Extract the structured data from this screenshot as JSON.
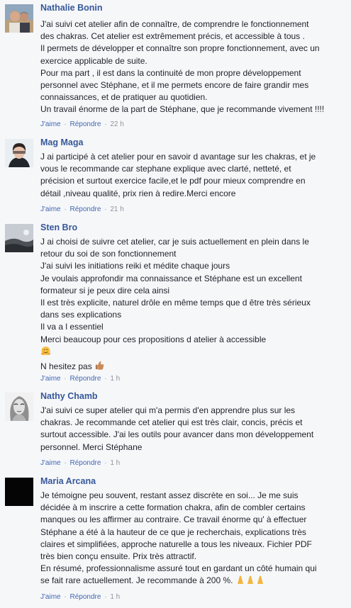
{
  "actions": {
    "like": "J'aime",
    "reply": "Répondre",
    "separator": "·"
  },
  "comments": [
    {
      "author": "Nathalie Bonin",
      "lines": [
        "J'ai suivi cet atelier afin de connaître, de comprendre le fonctionnement",
        "des chakras. Cet atelier est extrêmement précis, et accessible à tous .",
        "Il permets de développer et connaître son propre fonctionnement, avec un",
        "exercice applicable de suite.",
        "Pour ma part , il est dans la continuité de mon propre développement",
        "personnel avec Stéphane, et il me permets encore de faire grandir mes",
        "connaissances, et de pratiquer au quotidien.",
        "Un travail énorme de la part de Stéphane, que je recommande vivement !!!!"
      ],
      "time": "22 h"
    },
    {
      "author": "Mag Maga",
      "lines": [
        "J ai participé à cet atelier pour en savoir d avantage sur les chakras, et je",
        "vous le recommande car stephane explique avec clarté, netteté, et",
        "précision et surtout exercice facile,et le pdf pour mieux comprendre en",
        "détail ,niveau qualité, prix rien à redire.Merci encore"
      ],
      "time": "21 h"
    },
    {
      "author": "Sten Bro",
      "lines": [
        "J ai choisi de suivre cet atelier, car je suis actuellement en plein dans le",
        "retour du soi de son fonctionnement",
        "J'ai suivi les initiations reiki et médite chaque jours",
        "Je voulais approfondir ma connaissance et Stéphane est un excellent",
        "formateur si je peux dire cela ainsi",
        "Il est très explicite, naturel drôle en même temps que d être très sérieux",
        "dans ses explications",
        "Il va a l essentiel",
        "Merci beaucoup pour ces propositions d atelier à accessible"
      ],
      "emoji_line_icon": "hugging-face-emoji",
      "last_line": "N hesitez pas",
      "last_line_icon": "thumbs-up-emoji",
      "time": "1 h"
    },
    {
      "author": "Nathy Chamb",
      "lines": [
        "J'ai suivi ce super atelier qui m'a permis d'en apprendre plus sur les",
        "chakras. Je recommande cet atelier qui est très clair, concis, précis et",
        "surtout accessible. J'ai les outils pour avancer dans mon développement",
        "personnel. Merci Stéphane"
      ],
      "time": "1 h"
    },
    {
      "author": "Maria Arcana",
      "lines": [
        "Je témoigne peu souvent, restant assez discrète en soi... Je me suis",
        "décidée à m inscrire a cette formation chakra, afin de combler certains",
        "manques ou les affirmer au contraire. Ce travail énorme qu' à effectuer",
        "Stéphane a été à la hauteur de ce que je recherchais, explications très",
        "claires et simplifiées, approche naturelle a tous les niveaux. Fichier PDF",
        "très bien conçu ensuite. Prix très attractif.",
        "En résumé, professionnalisme assuré tout en gardant un côté humain qui",
        "se fait rare actuellement. Je recommande à 200 %."
      ],
      "last_line_icon": "praying-hands-emoji",
      "time": "1 h"
    }
  ],
  "colors": {
    "author": "#365899",
    "link": "#4267b2",
    "meta": "#90949c",
    "text": "#1d2129",
    "background": "#f6f7f9"
  }
}
